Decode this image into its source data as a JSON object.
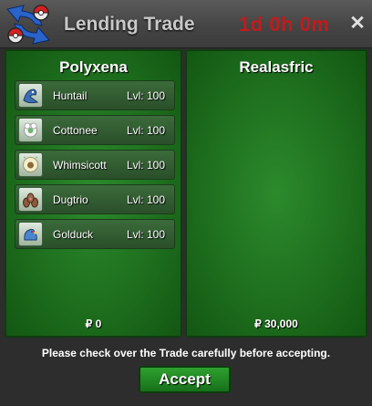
{
  "window": {
    "title": "Lending Trade",
    "timer": "1d 0h 0m",
    "close_label": "✕"
  },
  "left_panel": {
    "player": "Polyxena",
    "money": "₽ 0",
    "pokemon": [
      {
        "name": "Huntail",
        "level": "Lvl: 100",
        "icon": "huntail-icon"
      },
      {
        "name": "Cottonee",
        "level": "Lvl: 100",
        "icon": "cottonee-icon"
      },
      {
        "name": "Whimsicott",
        "level": "Lvl: 100",
        "icon": "whimsicott-icon"
      },
      {
        "name": "Dugtrio",
        "level": "Lvl: 100",
        "icon": "dugtrio-icon"
      },
      {
        "name": "Golduck",
        "level": "Lvl: 100",
        "icon": "golduck-icon"
      }
    ]
  },
  "right_panel": {
    "player": "Realasfric",
    "money": "₽ 30,000"
  },
  "footer": {
    "notice": "Please check over the Trade carefully before accepting.",
    "accept_label": "Accept"
  },
  "colors": {
    "timer": "#c21b1b",
    "panel_green": "#1e6f1e",
    "accept_green": "#2fa02f"
  }
}
